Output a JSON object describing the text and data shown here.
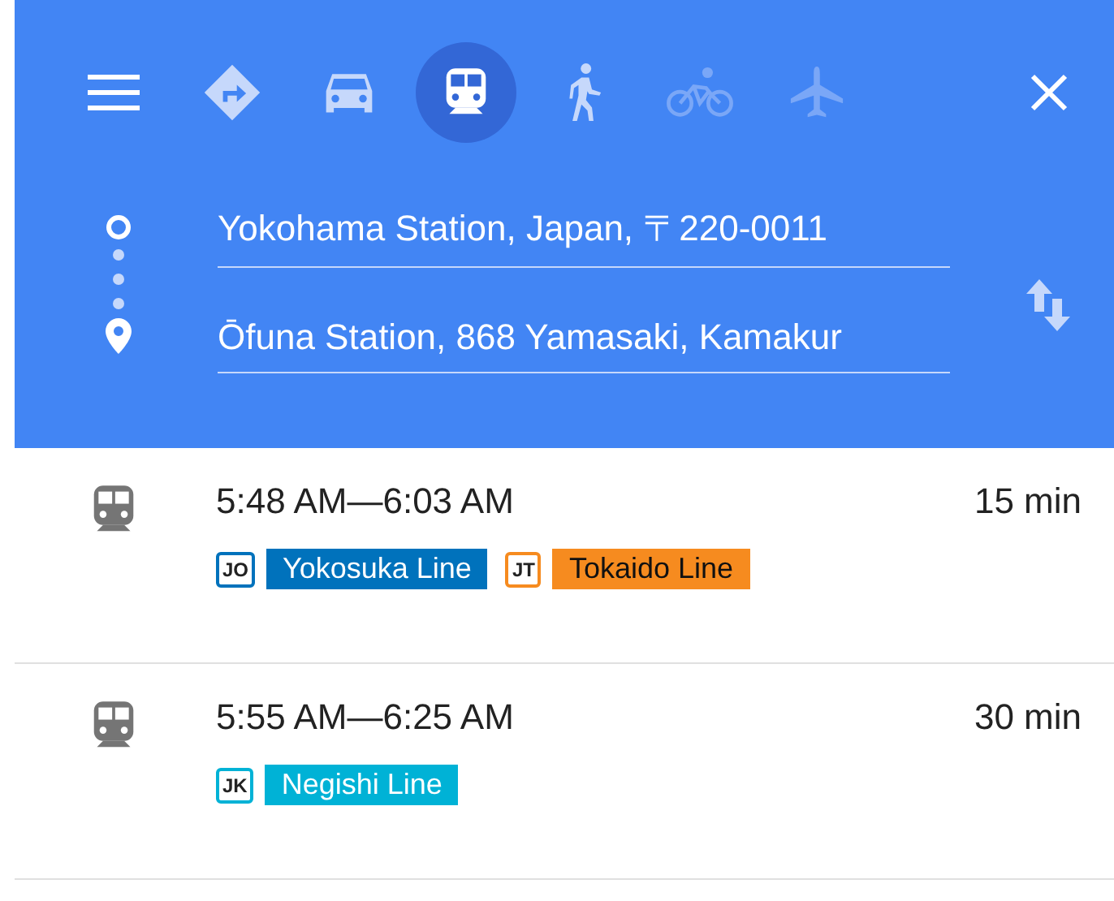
{
  "modes": [
    {
      "kind": "best",
      "selected": false,
      "disabled": false
    },
    {
      "kind": "car",
      "selected": false,
      "disabled": false
    },
    {
      "kind": "transit",
      "selected": true,
      "disabled": false
    },
    {
      "kind": "walk",
      "selected": false,
      "disabled": false
    },
    {
      "kind": "bike",
      "selected": false,
      "disabled": true
    },
    {
      "kind": "flight",
      "selected": false,
      "disabled": true
    }
  ],
  "origin": {
    "value": "Yokohama Station, Japan, 〒220-0011"
  },
  "destination": {
    "value": "Ōfuna Station, 868 Yamasaki, Kamakur"
  },
  "routes": [
    {
      "times": "5:48 AM—6:03 AM",
      "duration": "15 min",
      "lines": [
        {
          "code": "JO",
          "name": "Yokosuka Line",
          "color": "#0072bc",
          "dark_text": false
        },
        {
          "code": "JT",
          "name": "Tokaido Line",
          "color": "#f68b1f",
          "dark_text": true
        }
      ]
    },
    {
      "times": "5:55 AM—6:25 AM",
      "duration": "30 min",
      "lines": [
        {
          "code": "JK",
          "name": "Negishi Line",
          "color": "#00b2d6",
          "dark_text": false
        }
      ]
    }
  ]
}
